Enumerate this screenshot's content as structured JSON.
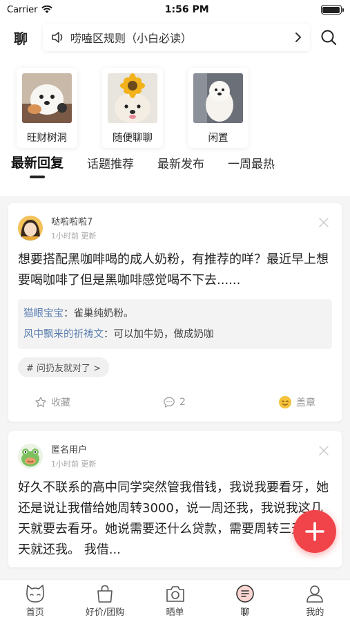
{
  "status": {
    "carrier": "Carrier",
    "time": "1:56 PM"
  },
  "header": {
    "title": "聊",
    "notice": "唠嗑区规则（小白必读）"
  },
  "boards": [
    {
      "label": "旺财树洞",
      "icon": "white-puppy-photo"
    },
    {
      "label": "随便聊聊",
      "icon": "dog-with-sunflower-photo"
    },
    {
      "label": "闲置",
      "icon": "fluffy-dog-photo"
    }
  ],
  "tabs": [
    "最新回复",
    "话题推荐",
    "最新发布",
    "一周最热"
  ],
  "posts": [
    {
      "author": "哒啦啦啦7",
      "meta": "1小时前 更新",
      "content": "想要搭配黑咖啡喝的成人奶粉，有推荐的咩？最近早上想要喝咖啡了但是黑咖啡感觉喝不下去......",
      "comments": [
        {
          "who": "猫眼宝宝",
          "text": "：雀巢纯奶粉。"
        },
        {
          "who": "风中飘来的祈祷文",
          "text": "：可以加牛奶，做成奶咖"
        }
      ],
      "topic": "# 问扔友就对了 >",
      "favorite_label": "收藏",
      "comment_count": "2",
      "stamp_label": "盖章"
    },
    {
      "author": "匿名用户",
      "meta": "1小时前 更新",
      "content": "好久不联系的高中同学突然管我借钱，我说我要看牙，她还是说让我借给她周转3000，说一周还我，我说我这几天就要去看牙。她说需要还什么贷款，需要周转三天，三天就还我。 我借..."
    }
  ],
  "nav": [
    {
      "label": "首页",
      "icon": "cat-face-icon"
    },
    {
      "label": "好价/团购",
      "icon": "shopping-bag-icon"
    },
    {
      "label": "晒单",
      "icon": "camera-icon"
    },
    {
      "label": "聊",
      "icon": "chat-icon"
    },
    {
      "label": "我的",
      "icon": "person-icon"
    }
  ],
  "colors": {
    "accent": "#f0444a",
    "link": "#5b7fb1"
  }
}
